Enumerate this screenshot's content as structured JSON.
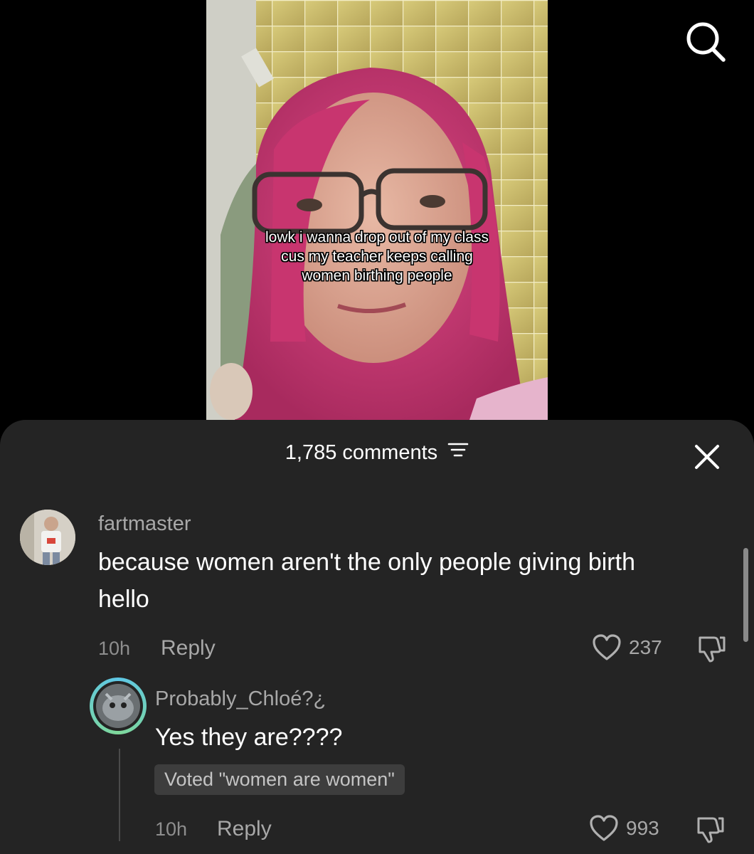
{
  "video": {
    "caption_lines": [
      "lowk i wanna drop out of my class",
      "cus my teacher keeps calling",
      "women birthing people"
    ]
  },
  "top_bar": {
    "search_icon": "search-icon"
  },
  "comments_sheet": {
    "title": "1,785 comments",
    "sort_icon": "sort-lines-icon",
    "close_icon": "close-icon",
    "comments": [
      {
        "username": "fartmaster",
        "text_line1": "because women aren't the only people giving birth",
        "text_line2": "hello",
        "time": "10h",
        "reply_label": "Reply",
        "likes": "237"
      }
    ],
    "replies": [
      {
        "username": "Probably_Chloé?¿",
        "text": "Yes they are????",
        "vote_badge": "Voted \"women are women\"",
        "time": "10h",
        "reply_label": "Reply",
        "likes": "993"
      }
    ]
  },
  "colors": {
    "sheet_bg": "#242424",
    "page_bg": "#000000",
    "muted_text": "#a8a8a8",
    "badge_bg": "#3d3d3d",
    "story_ring": "#5ec7e6"
  }
}
